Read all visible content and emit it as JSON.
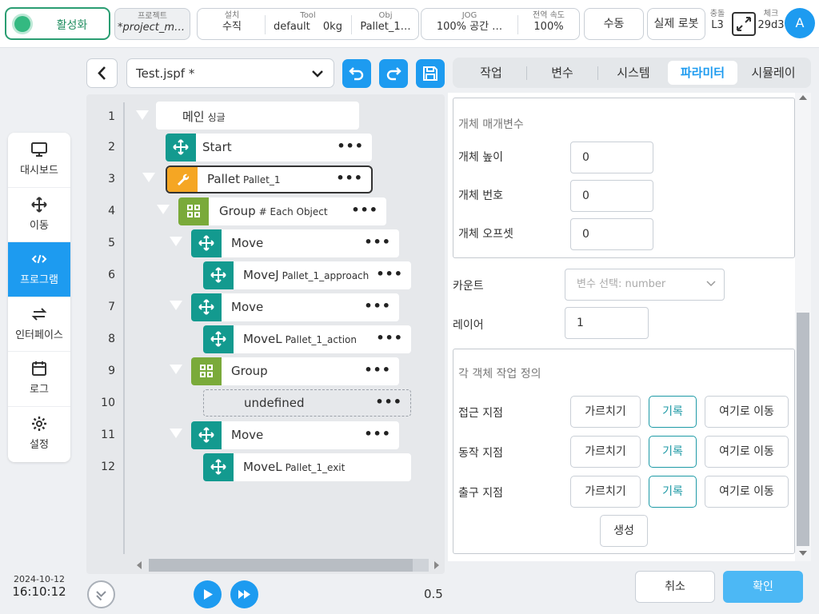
{
  "topbar": {
    "activate_label": "활성화",
    "project_label": "프로젝트",
    "project_value": "*project_mo…",
    "setup_label": "설치",
    "setup_value": "수직",
    "tool_label": "Tool",
    "tool_value": "default",
    "tool_weight": "0kg",
    "obj_label": "Obj",
    "obj_value": "Pallet_1…",
    "jog_label": "JOG",
    "jog_value": "100%  공간 …",
    "global_speed_label": "전역 속도",
    "global_speed_value": "100%",
    "manual_label": "수동",
    "real_robot_label": "실제 로봇",
    "collision_label": "충돌",
    "collision_value": "L3",
    "check_label": "체크",
    "check_value": "29d3",
    "avatar_letter": "A"
  },
  "sidebar": {
    "items": [
      {
        "label": "대시보드",
        "icon": "monitor-icon"
      },
      {
        "label": "이동",
        "icon": "move-icon"
      },
      {
        "label": "프로그램",
        "icon": "code-icon"
      },
      {
        "label": "인터페이스",
        "icon": "swap-icon"
      },
      {
        "label": "로그",
        "icon": "calendar-icon"
      },
      {
        "label": "설정",
        "icon": "gear-icon"
      }
    ]
  },
  "datetime": {
    "date": "2024-10-12",
    "time": "16:10:12"
  },
  "editor": {
    "file_name": "Test.jspf *",
    "speed": "0.5",
    "nodes": [
      {
        "line": "1",
        "label": "메인",
        "sub": "싱글"
      },
      {
        "line": "2",
        "label": "Start",
        "sub": ""
      },
      {
        "line": "3",
        "label": "Pallet",
        "sub": "Pallet_1"
      },
      {
        "line": "4",
        "label": "Group",
        "sub": "# Each Object"
      },
      {
        "line": "5",
        "label": "Move",
        "sub": ""
      },
      {
        "line": "6",
        "label": "MoveJ",
        "sub": "Pallet_1_approach"
      },
      {
        "line": "7",
        "label": "Move",
        "sub": ""
      },
      {
        "line": "8",
        "label": "MoveL",
        "sub": "Pallet_1_action"
      },
      {
        "line": "9",
        "label": "Group",
        "sub": ""
      },
      {
        "line": "10",
        "label": "undefined",
        "sub": ""
      },
      {
        "line": "11",
        "label": "Move",
        "sub": ""
      },
      {
        "line": "12",
        "label": "MoveL",
        "sub": "Pallet_1_exit"
      }
    ],
    "more_glyph": "•••"
  },
  "tabs": [
    {
      "label": "작업"
    },
    {
      "label": "변수"
    },
    {
      "label": "시스템"
    },
    {
      "label": "파라미터",
      "active": true
    },
    {
      "label": "시뮬레이"
    }
  ],
  "params": {
    "object_params_title": "개체 매개변수",
    "object_height_label": "개체 높이",
    "object_height_value": "0",
    "object_number_label": "개체 번호",
    "object_number_value": "0",
    "object_offset_label": "개체 오프셋",
    "object_offset_value": "0",
    "count_label": "카운트",
    "count_placeholder": "변수 선택: number",
    "layer_label": "레이어",
    "layer_value": "1",
    "per_object_title": "각 객체 작업 정의",
    "approach_label": "접근 지점",
    "action_label": "동작 지점",
    "exit_label": "출구 지점",
    "teach_label": "가르치기",
    "record_label": "기록",
    "move_here_label": "여기로 이동",
    "generate_label": "생성"
  },
  "footer": {
    "cancel_label": "취소",
    "confirm_label": "확인"
  },
  "colors": {
    "accent": "#1d9bf0",
    "teal": "#139a8f",
    "orange": "#f5a623",
    "green": "#7aaa3a",
    "active_green": "#2a9d72"
  }
}
